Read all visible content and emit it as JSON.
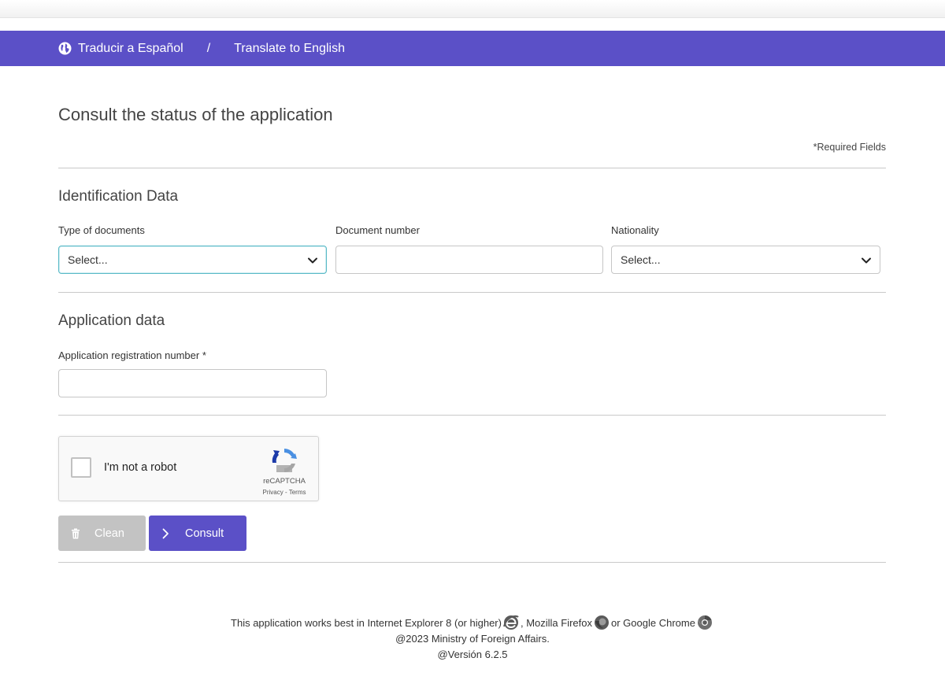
{
  "language_bar": {
    "spanish_label": "Traducir a Español",
    "separator": "/",
    "english_label": "Translate to English",
    "background_color": "#5b50c7",
    "icon": "globe-icon"
  },
  "page": {
    "title": "Consult the status of the application",
    "required_note": "*Required Fields"
  },
  "identification": {
    "title": "Identification Data",
    "document_type": {
      "label": "Type of documents",
      "selected": "Select..."
    },
    "document_number": {
      "label": "Document number",
      "value": ""
    },
    "nationality": {
      "label": "Nationality",
      "selected": "Select..."
    }
  },
  "application": {
    "title": "Application data",
    "registration_number": {
      "label": "Application registration number *",
      "value": ""
    }
  },
  "captcha": {
    "label": "I'm not a robot",
    "brand": "reCAPTCHA",
    "links": "Privacy - Terms",
    "checked": false
  },
  "buttons": {
    "clean": {
      "label": "Clean",
      "icon": "trash-icon",
      "color": "#c3c3c3"
    },
    "consult": {
      "label": "Consult",
      "icon": "chevron-right-icon",
      "color": "#5b50c7"
    }
  },
  "footer": {
    "browser_text_1": "This application works best in Internet Explorer 8 (or higher)",
    "browser_text_2": ", Mozilla Firefox",
    "browser_text_3": "or Google Chrome",
    "copyright": "@2023 Ministry of Foreign Affairs.",
    "version": "@Versión 6.2.5",
    "icons": [
      "internet-explorer-icon",
      "firefox-icon",
      "chrome-icon"
    ]
  }
}
